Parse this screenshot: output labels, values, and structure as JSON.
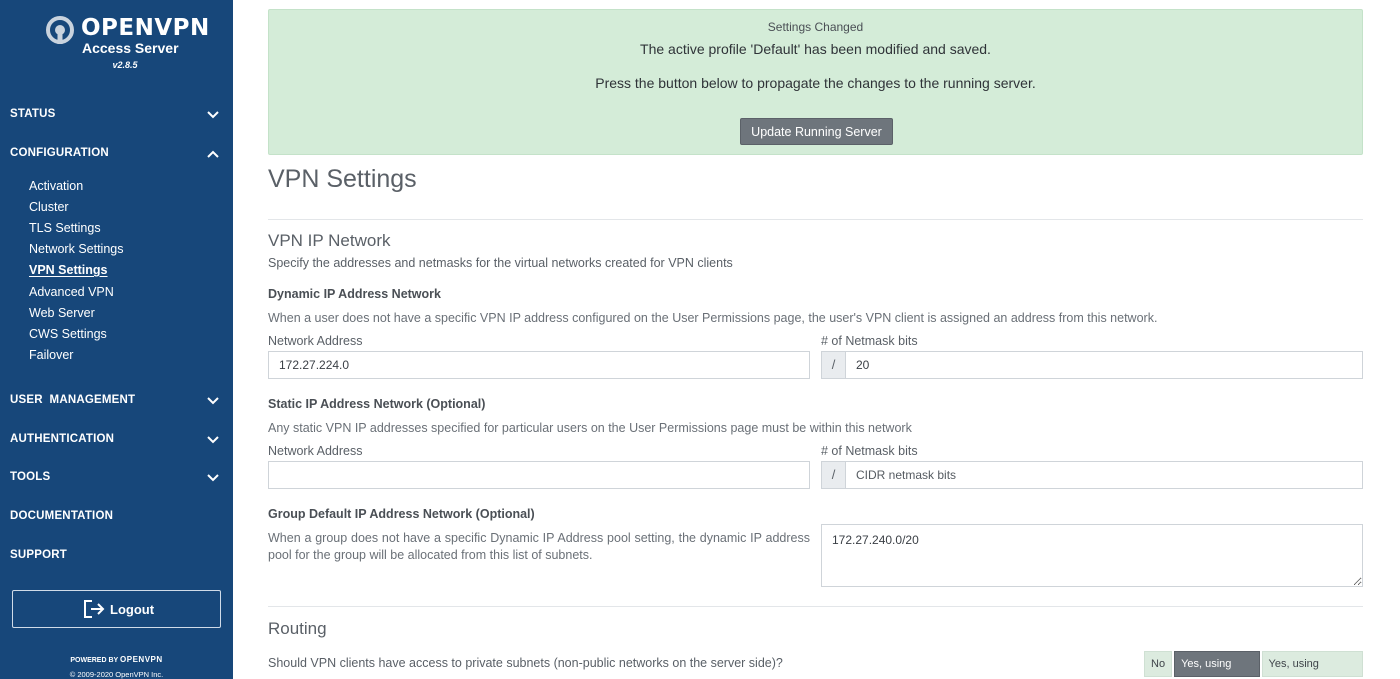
{
  "sidebar": {
    "brand": "OPENVPN",
    "product": "Access Server",
    "version": "v2.8.5",
    "sections": [
      {
        "label": "STATUS",
        "chevron": "chevron-down-icon"
      },
      {
        "label": "CONFIGURATION",
        "chevron": "chevron-up-icon"
      },
      {
        "label": "USER  MANAGEMENT",
        "chevron": "chevron-down-icon"
      },
      {
        "label": "AUTHENTICATION",
        "chevron": "chevron-down-icon"
      },
      {
        "label": "TOOLS",
        "chevron": "chevron-down-icon"
      },
      {
        "label": "DOCUMENTATION"
      },
      {
        "label": "SUPPORT"
      }
    ],
    "config_items": [
      "Activation",
      "Cluster",
      "TLS Settings",
      "Network Settings",
      "VPN Settings",
      "Advanced VPN",
      "Web Server",
      "CWS Settings",
      "Failover"
    ],
    "active_item": "VPN Settings",
    "logout_label": "Logout",
    "powered_by": "POWERED BY",
    "powered_logo": "OPENVPN",
    "copyright": "© 2009-2020 OpenVPN Inc."
  },
  "alert": {
    "title": "Settings Changed",
    "line1": "The active profile 'Default' has been modified and saved.",
    "line2": "Press the button below to propagate the changes to the running server.",
    "button": "Update Running Server"
  },
  "page": {
    "title": "VPN Settings"
  },
  "vpn_ip_network": {
    "title": "VPN IP Network",
    "description": "Specify the addresses and netmasks for the virtual networks created for VPN clients",
    "dynamic": {
      "title": "Dynamic IP Address Network",
      "help_pre": "When a user does not have a specific VPN IP address configured on the ",
      "help_link": "User Permissions",
      "help_post": " page, the user's VPN client is assigned an address from this network.",
      "network_label": "Network Address",
      "network_value": "172.27.224.0",
      "netmask_label": "# of Netmask bits",
      "slash": "/",
      "netmask_value": "20"
    },
    "static": {
      "title": "Static IP Address Network (Optional)",
      "help_pre": "Any static VPN IP addresses specified for particular users on the ",
      "help_link": "User Permissions",
      "help_post": " page must be within this network",
      "network_label": "Network Address",
      "network_value": "",
      "netmask_label": "# of Netmask bits",
      "slash": "/",
      "netmask_placeholder": "CIDR netmask bits"
    },
    "group": {
      "title": "Group Default IP Address Network (Optional)",
      "help": "When a group does not have a specific Dynamic IP Address pool setting, the dynamic IP address pool for the group will be allocated from this list of subnets.",
      "value": "172.27.240.0/20"
    }
  },
  "routing": {
    "title": "Routing",
    "question": "Should VPN clients have access to private subnets (non-public networks on the server side)?",
    "options": [
      "No",
      "Yes, using NAT",
      "Yes, using Routing"
    ],
    "selected": "Yes, using NAT"
  },
  "colors": {
    "sidebar_bg": "#17477a",
    "alert_bg": "#d4ecd8",
    "button_gray": "#6e757c"
  }
}
